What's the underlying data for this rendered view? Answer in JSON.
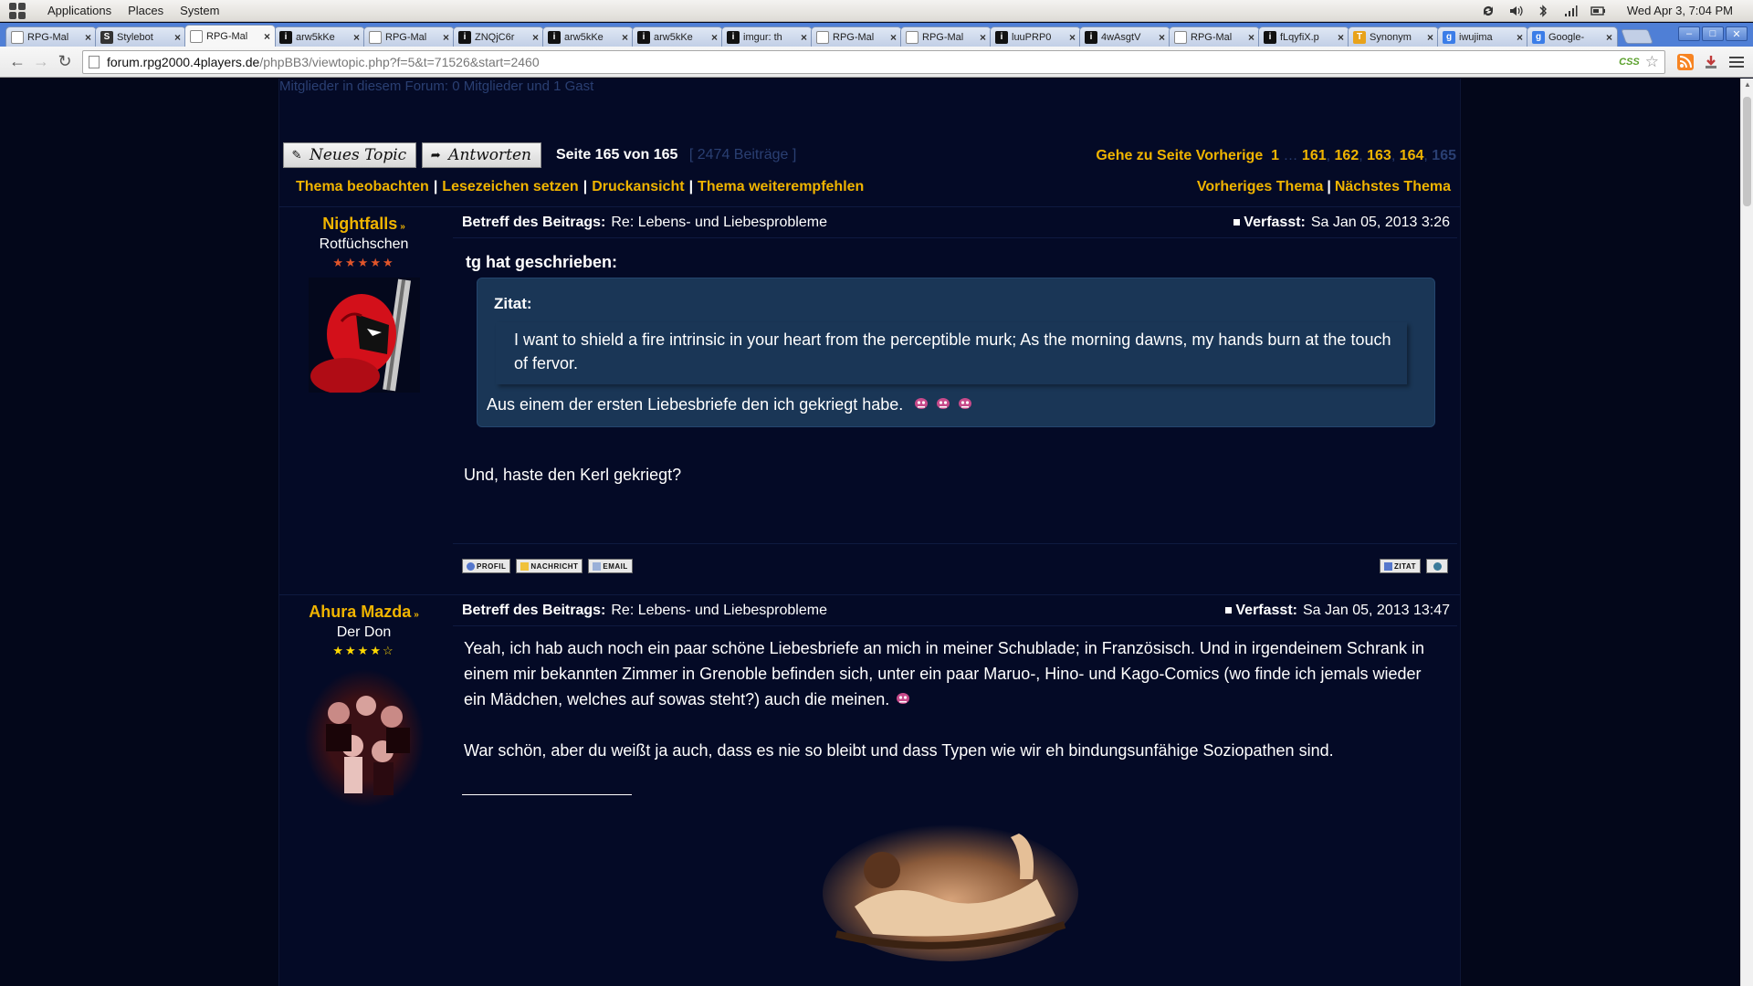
{
  "os_panel": {
    "menus": [
      "Applications",
      "Places",
      "System"
    ],
    "clock": "Wed Apr 3, 7:04 PM"
  },
  "tabs": [
    {
      "title": "RPG-Mal",
      "favicon": "page"
    },
    {
      "title": "Stylebot",
      "favicon": "s"
    },
    {
      "title": "RPG-Mal",
      "favicon": "page",
      "active": true
    },
    {
      "title": "arw5kKe",
      "favicon": "dark"
    },
    {
      "title": "RPG-Mal",
      "favicon": "page"
    },
    {
      "title": "ZNQjC6r",
      "favicon": "dark"
    },
    {
      "title": "arw5kKe",
      "favicon": "dark"
    },
    {
      "title": "arw5kKe",
      "favicon": "dark"
    },
    {
      "title": "imgur: th",
      "favicon": "dark"
    },
    {
      "title": "RPG-Mal",
      "favicon": "page"
    },
    {
      "title": "RPG-Mal",
      "favicon": "page"
    },
    {
      "title": "luuPRP0",
      "favicon": "dark"
    },
    {
      "title": "4wAsgtV",
      "favicon": "dark"
    },
    {
      "title": "RPG-Mal",
      "favicon": "page"
    },
    {
      "title": "fLqyfiX.p",
      "favicon": "dark"
    },
    {
      "title": "Synonym",
      "favicon": "syn"
    },
    {
      "title": "iwujima",
      "favicon": "g"
    },
    {
      "title": "Google-",
      "favicon": "g"
    }
  ],
  "address": {
    "host": "forum.rpg2000.4players.de",
    "path": "/phpBB3/viewtopic.php?f=5&t=71526&start=2460",
    "ext_label": "CSS"
  },
  "forum": {
    "who_online": "Mitglieder in diesem Forum: 0 Mitglieder und 1 Gast",
    "new_topic": "Neues Topic",
    "reply": "Antworten",
    "page_info": "Seite 165 von 165",
    "post_count": "[ 2474 Beiträge ]",
    "pagination": {
      "goto": "Gehe zu Seite",
      "prev": "Vorherige",
      "pages": [
        "1",
        "…",
        "161",
        "162",
        "163",
        "164",
        "165"
      ],
      "current": "165"
    },
    "links": [
      "Thema beobachten",
      "Lesezeichen setzen",
      "Druckansicht",
      "Thema weiterempfehlen"
    ],
    "topic_nav": [
      "Vorheriges Thema",
      "Nächstes Thema"
    ],
    "colors": {
      "link": "#f0b400",
      "muted": "#2a3f72",
      "quote_bg": "#1a3656",
      "page_bg": "#03071a"
    }
  },
  "posts": [
    {
      "author": "Nightfalls",
      "rank": "Rotfüchschen",
      "stars": 5,
      "max_stars": 5,
      "subject_label": "Betreff des Beitrags:",
      "subject": "Re: Lebens- und Liebesprobleme",
      "posted_label": "Verfasst:",
      "posted": "Sa Jan 05, 2013 3:26",
      "quote_author": "tg hat geschrieben:",
      "inner_quote_title": "Zitat:",
      "inner_quote": "I want to shield a fire intrinsic in your heart from the perceptible murk; As the morning dawns, my hands burn at the touch of fervor.",
      "quote_reply": "Aus einem der ersten Liebesbriefe den ich gekriegt habe.",
      "text": "Und, haste den Kerl gekriegt?",
      "buttons": [
        "PROFIL",
        "NACHRICHT",
        "EMAIL"
      ],
      "right_buttons": [
        "ZITAT"
      ]
    },
    {
      "author": "Ahura Mazda",
      "rank": "Der Don",
      "stars": 4,
      "max_stars": 5,
      "subject_label": "Betreff des Beitrags:",
      "subject": "Re: Lebens- und Liebesprobleme",
      "posted_label": "Verfasst:",
      "posted": "Sa Jan 05, 2013 13:47",
      "paragraph1": "Yeah, ich hab auch noch ein paar schöne Liebesbriefe an mich in meiner Schublade; in Französisch. Und in irgendeinem Schrank in einem mir bekannten Zimmer in Grenoble befinden sich, unter ein paar Maruo-, Hino- und Kago-Comics (wo finde ich jemals wieder ein Mädchen, welches auf sowas steht?) auch die meinen.",
      "paragraph2": "War schön, aber du weißt ja auch, dass es nie so bleibt und dass Typen wie wir eh bindungsunfähige Soziopathen sind."
    }
  ]
}
